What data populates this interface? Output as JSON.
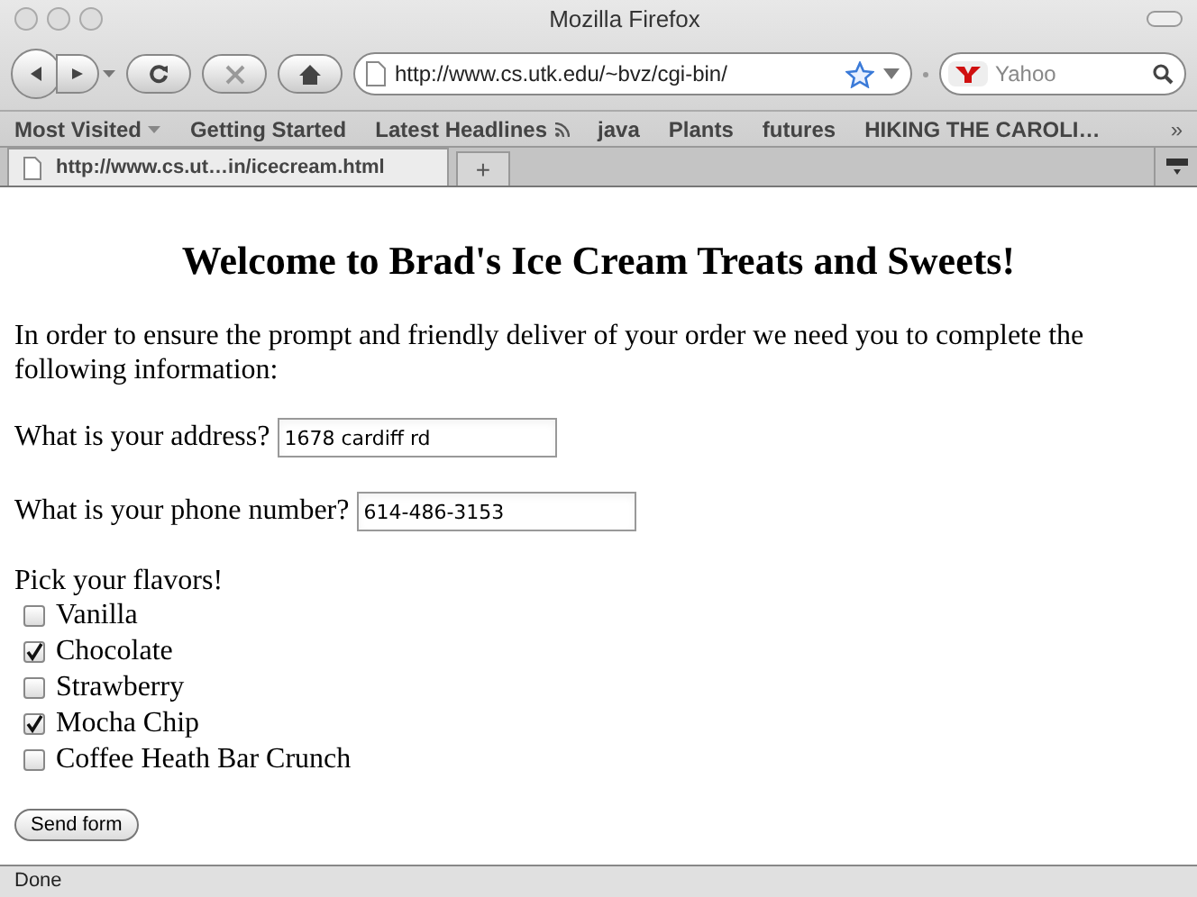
{
  "window": {
    "title": "Mozilla Firefox"
  },
  "toolbar": {
    "url": "http://www.cs.utk.edu/~bvz/cgi-bin/",
    "search_placeholder": "Yahoo"
  },
  "bookmarks": [
    {
      "label": "Most Visited",
      "kind": "menu"
    },
    {
      "label": "Getting Started",
      "kind": "link"
    },
    {
      "label": "Latest Headlines",
      "kind": "feed"
    },
    {
      "label": "java",
      "kind": "link"
    },
    {
      "label": "Plants",
      "kind": "link"
    },
    {
      "label": "futures",
      "kind": "link"
    },
    {
      "label": "HIKING THE CAROLI…",
      "kind": "link"
    }
  ],
  "bookmarks_overflow": "»",
  "tabs": [
    {
      "label": "http://www.cs.ut…in/icecream.html",
      "selected": true
    }
  ],
  "new_tab": "+",
  "page": {
    "heading": "Welcome to Brad's Ice Cream Treats and Sweets!",
    "intro": "In order to ensure the prompt and friendly deliver of your order we need you to complete the following information:",
    "fields": [
      {
        "label": "What is your address?",
        "value": "1678 cardiff rd"
      },
      {
        "label": "What is your phone number?",
        "value": "614-486-3153"
      }
    ],
    "flavors_label": "Pick your flavors!",
    "flavors": [
      {
        "label": "Vanilla",
        "checked": false
      },
      {
        "label": "Chocolate",
        "checked": true
      },
      {
        "label": "Strawberry",
        "checked": false
      },
      {
        "label": "Mocha Chip",
        "checked": true
      },
      {
        "label": "Coffee Heath Bar Crunch",
        "checked": false
      }
    ],
    "submit": "Send form"
  },
  "status_bar": "Done"
}
